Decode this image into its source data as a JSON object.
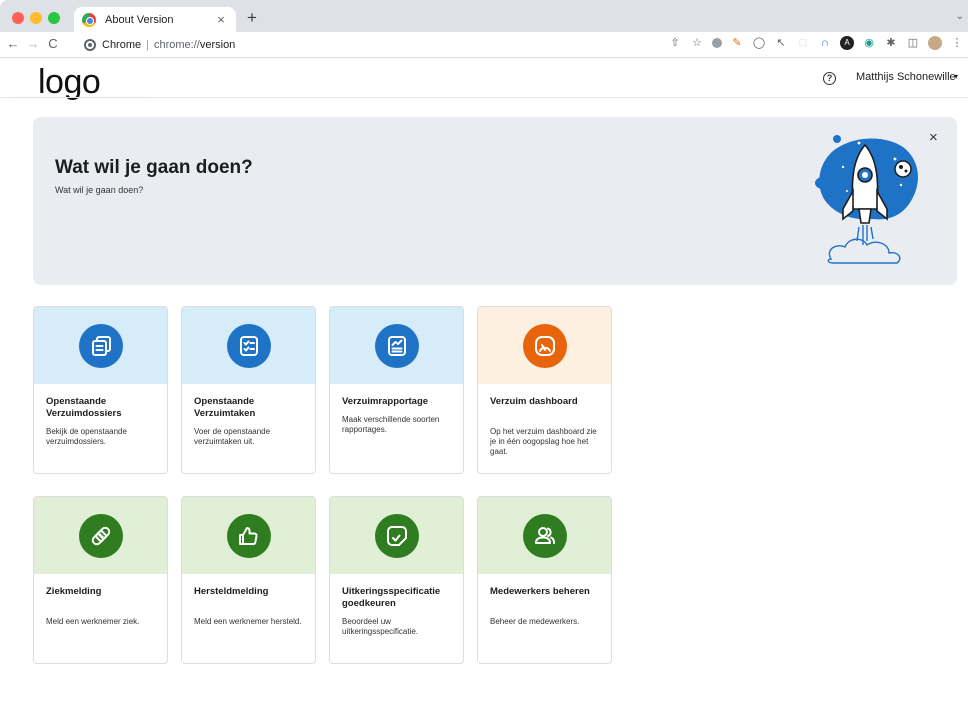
{
  "browser": {
    "tab_title": "About Version",
    "tab_close": "×",
    "new_tab": "+",
    "nav_back": "←",
    "nav_forward": "→",
    "nav_reload": "C",
    "site_name": "Chrome",
    "url_separator": "|",
    "url_scheme": "chrome://",
    "url_path": "version"
  },
  "header": {
    "logo": "logo",
    "help": "?",
    "user_name": "Matthijs Schonewille",
    "user_caret": "▾"
  },
  "hero": {
    "title": "Wat wil je gaan doen?",
    "subtitle": "Wat wil je gaan doen?",
    "close": "×"
  },
  "tiles": [
    {
      "title": "Openstaande Verzuimdossiers",
      "description": "Bekijk de openstaande verzuimdossiers.",
      "icon": "documents-icon",
      "color": "#1f73c7"
    },
    {
      "title": "Openstaande Verzuimtaken",
      "description": "Voer de openstaande verzuimtaken uit.",
      "icon": "checklist-icon",
      "color": "#1f73c7"
    },
    {
      "title": "Verzuimrapportage",
      "description": "Maak verschillende soorten rapportages.",
      "icon": "report-icon",
      "color": "#1f73c7"
    },
    {
      "title": "Verzuim dashboard",
      "description": "Op het verzuim dashboard zie je in één oogopslag hoe het gaat.",
      "icon": "gauge-icon",
      "color": "#e8640a"
    },
    {
      "title": "Ziekmelding",
      "description": "Meld een werknemer ziek.",
      "icon": "bandage-icon",
      "color": "#2f7c21"
    },
    {
      "title": "Hersteldmelding",
      "description": "Meld een werknemer hersteld.",
      "icon": "thumbs-up-icon",
      "color": "#2f7c21"
    },
    {
      "title": "Uitkeringsspecificatie goedkeuren",
      "description": "Beoordeel uw uitkeringsspecificatie.",
      "icon": "approve-icon",
      "color": "#2f7c21"
    },
    {
      "title": "Medewerkers beheren",
      "description": "Beheer de medewerkers.",
      "icon": "users-icon",
      "color": "#2f7c21"
    }
  ]
}
